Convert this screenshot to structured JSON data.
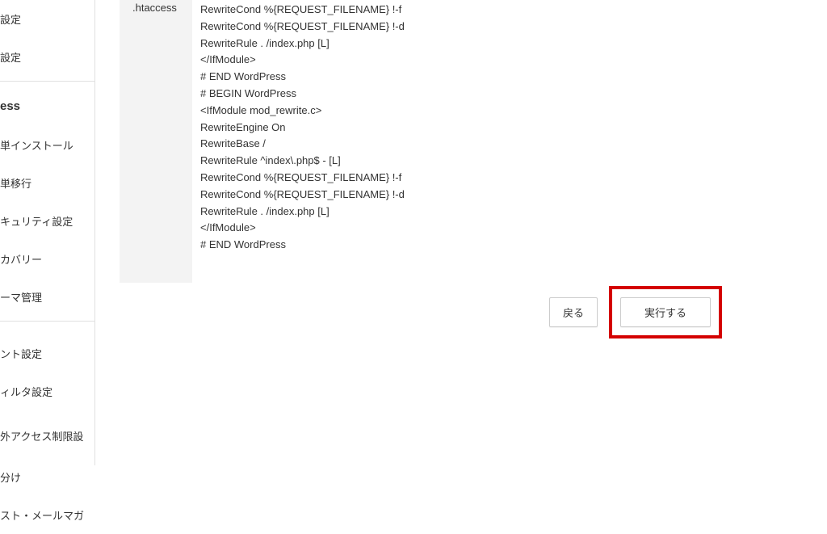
{
  "sidebar": {
    "items": [
      {
        "label": "設定"
      },
      {
        "label": "設定"
      }
    ],
    "section_header": "ess",
    "section_items": [
      {
        "label": "単インストール"
      },
      {
        "label": "単移行"
      },
      {
        "label": "キュリティ設定"
      },
      {
        "label": "カバリー"
      },
      {
        "label": "ーマ管理"
      }
    ],
    "lower_items": [
      {
        "label": "ント設定"
      },
      {
        "label": "ィルタ設定"
      },
      {
        "label": "外アクセス制限設"
      },
      {
        "label": "分け"
      },
      {
        "label": "スト・メールマガ"
      }
    ]
  },
  "main": {
    "label": ".htaccess",
    "code_lines": [
      "RewriteCond %{REQUEST_FILENAME} !-f",
      "RewriteCond %{REQUEST_FILENAME} !-d",
      "RewriteRule . /index.php [L]",
      "</IfModule>",
      "# END WordPress",
      "# BEGIN WordPress",
      "<IfModule mod_rewrite.c>",
      "RewriteEngine On",
      "RewriteBase /",
      "RewriteRule ^index\\.php$ - [L]",
      "RewriteCond %{REQUEST_FILENAME} !-f",
      "RewriteCond %{REQUEST_FILENAME} !-d",
      "RewriteRule . /index.php [L]",
      "</IfModule>",
      "# END WordPress"
    ],
    "buttons": {
      "back": "戻る",
      "execute": "実行する"
    }
  },
  "colors": {
    "highlight_border": "#d40000"
  }
}
